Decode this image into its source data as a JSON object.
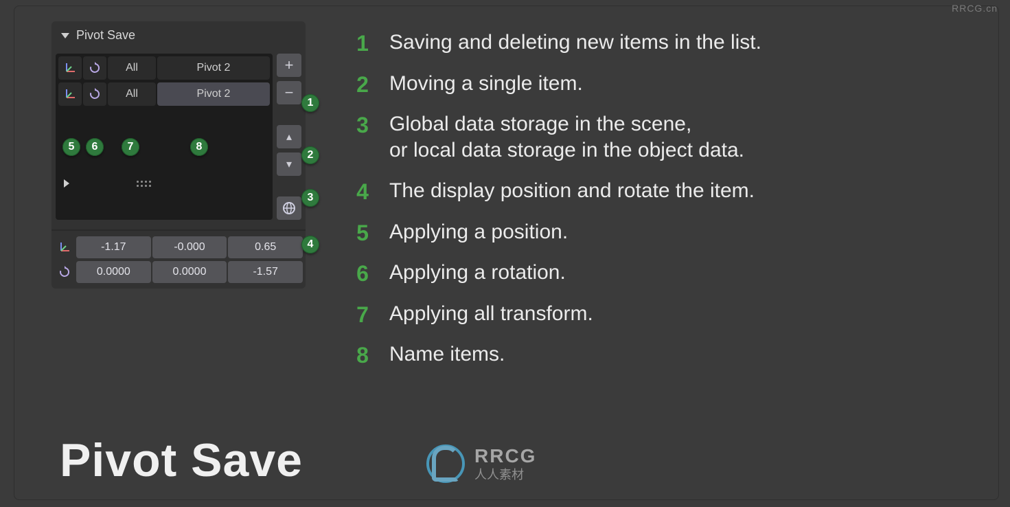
{
  "watermark_top": "RRCG.cn",
  "panel": {
    "title": "Pivot Save",
    "list": [
      {
        "all_label": "All",
        "name": "Pivot 2",
        "selected": false
      },
      {
        "all_label": "All",
        "name": "Pivot 2",
        "selected": true
      }
    ],
    "pos": {
      "x": "-1.17",
      "y": "-0.000",
      "z": "0.65"
    },
    "rot": {
      "x": "0.0000",
      "y": "0.0000",
      "z": "-1.57"
    }
  },
  "badges": {
    "b1": "1",
    "b2": "2",
    "b3": "3",
    "b4": "4",
    "b5": "5",
    "b6": "6",
    "b7": "7",
    "b8": "8"
  },
  "legend": [
    {
      "n": "1",
      "text": "Saving and deleting new items in the list."
    },
    {
      "n": "2",
      "text": "Moving a single item."
    },
    {
      "n": "3",
      "text": "Global data storage in the scene,\nor local data storage in the object data."
    },
    {
      "n": "4",
      "text": "The display position and rotate the item."
    },
    {
      "n": "5",
      "text": "Applying a position."
    },
    {
      "n": "6",
      "text": "Applying a rotation."
    },
    {
      "n": "7",
      "text": "Applying all transform."
    },
    {
      "n": "8",
      "text": "Name items."
    }
  ],
  "big_title": "Pivot Save",
  "logo": {
    "big": "RRCG",
    "small": "人人素材"
  }
}
